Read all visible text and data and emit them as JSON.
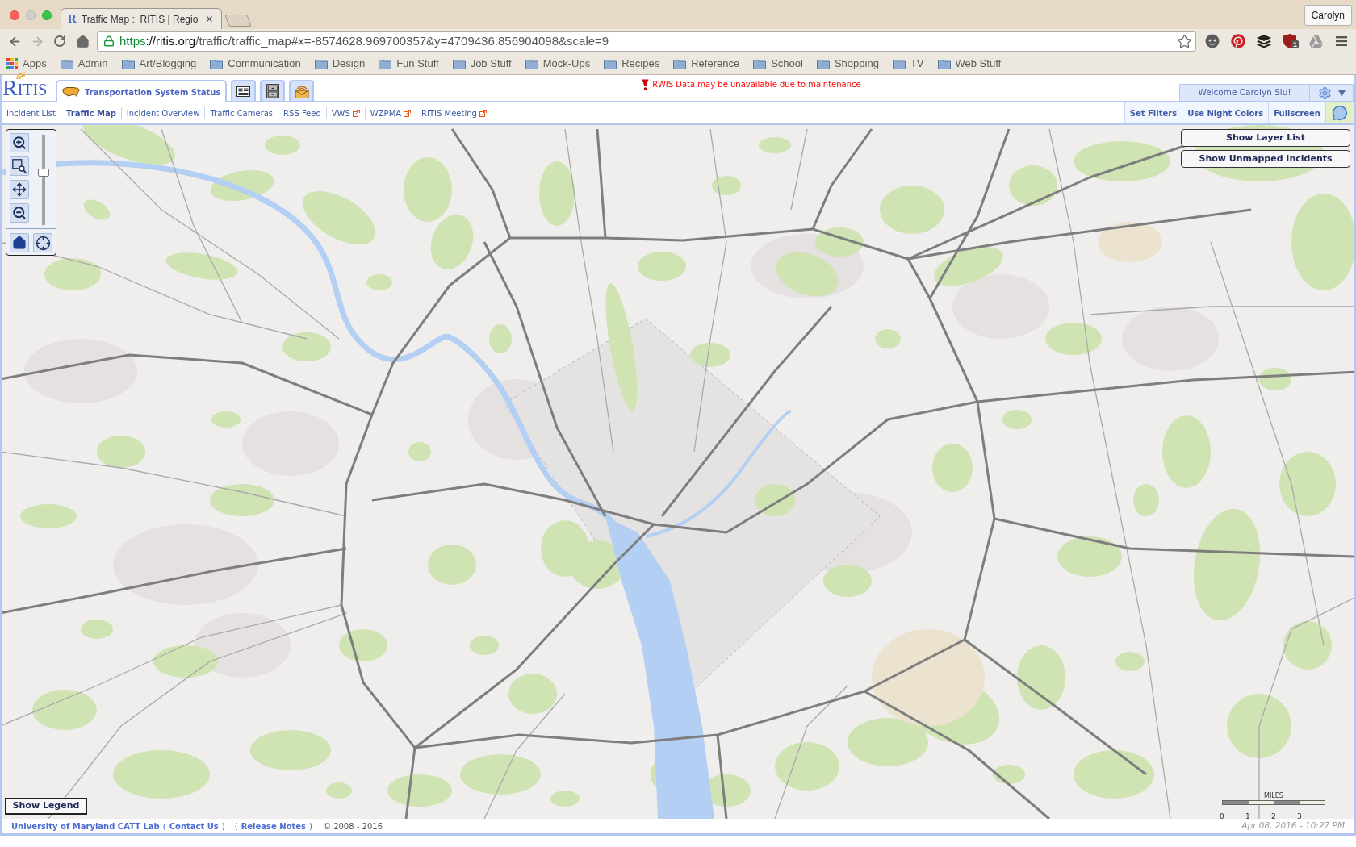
{
  "browser": {
    "tabs": [
      {
        "favicon": "R",
        "title": "Traffic Map :: RITIS | Regio",
        "selected": true
      }
    ],
    "profile": "Carolyn",
    "navigation": {
      "back_disabled": false,
      "forward_disabled": true
    },
    "address": {
      "secure": true,
      "parts": [
        {
          "kind": "scheme",
          "text": "https"
        },
        {
          "kind": "host",
          "text": "://ritis.org"
        },
        {
          "kind": "path",
          "text": "/traffic/traffic_map#x=-8574628.969700357&y=4709436.856904098&scale=9"
        }
      ]
    },
    "extension_badge": "1",
    "bookmarks": [
      {
        "kind": "apps",
        "label": "Apps"
      },
      {
        "kind": "folder",
        "label": "Admin"
      },
      {
        "kind": "folder",
        "label": "Art/Blogging"
      },
      {
        "kind": "folder",
        "label": "Communication"
      },
      {
        "kind": "folder",
        "label": "Design"
      },
      {
        "kind": "folder",
        "label": "Fun Stuff"
      },
      {
        "kind": "folder",
        "label": "Job Stuff"
      },
      {
        "kind": "folder",
        "label": "Mock-Ups"
      },
      {
        "kind": "folder",
        "label": "Recipes"
      },
      {
        "kind": "folder",
        "label": "Reference"
      },
      {
        "kind": "folder",
        "label": "School"
      },
      {
        "kind": "folder",
        "label": "Shopping"
      },
      {
        "kind": "folder",
        "label": "TV"
      },
      {
        "kind": "folder",
        "label": "Web Stuff"
      }
    ]
  },
  "app": {
    "logo": "RITIS",
    "tabs": [
      {
        "kind": "labeled",
        "label": "Transportation System Status",
        "selected": true
      },
      {
        "kind": "icon",
        "selected": false
      },
      {
        "kind": "icon",
        "selected": false
      },
      {
        "kind": "icon",
        "selected": false
      }
    ],
    "notice": "RWIS Data may be unavailable due to maintenance",
    "welcome": "Welcome Carolyn Siu!",
    "nav_links": [
      {
        "label": "Incident List",
        "selected": false,
        "external": false
      },
      {
        "label": "Traffic Map",
        "selected": true,
        "external": false
      },
      {
        "label": "Incident Overview",
        "selected": false,
        "external": false
      },
      {
        "label": "Traffic Cameras",
        "selected": false,
        "external": false
      },
      {
        "label": "RSS Feed",
        "selected": false,
        "external": false
      },
      {
        "label": "VWS",
        "selected": false,
        "external": true
      },
      {
        "label": "WZPMA",
        "selected": false,
        "external": true
      },
      {
        "label": "RITIS Meeting",
        "selected": false,
        "external": true
      }
    ],
    "actions": [
      "Set Filters",
      "Use Night Colors",
      "Fullscreen"
    ],
    "map": {
      "zoom_slider": {
        "level": 0.58
      },
      "overlay_buttons": [
        "Show Layer List",
        "Show Unmapped Incidents"
      ],
      "legend_button": "Show Legend",
      "scale": {
        "unit": "MILES",
        "ticks": [
          "0",
          "1",
          "2",
          "3"
        ]
      }
    },
    "footer": {
      "parts": [
        {
          "kind": "link",
          "text": "University of Maryland CATT Lab"
        },
        {
          "kind": "open",
          "text": "("
        },
        {
          "kind": "link",
          "text": "Contact Us"
        },
        {
          "kind": "close",
          "text": ")"
        },
        {
          "kind": "open",
          "text": "("
        },
        {
          "kind": "link",
          "text": "Release Notes"
        },
        {
          "kind": "close",
          "text": ")"
        },
        {
          "kind": "plain",
          "text": "© 2008 - 2016"
        }
      ],
      "timestamp": "Apr 08, 2016 - 10:27 PM"
    }
  }
}
